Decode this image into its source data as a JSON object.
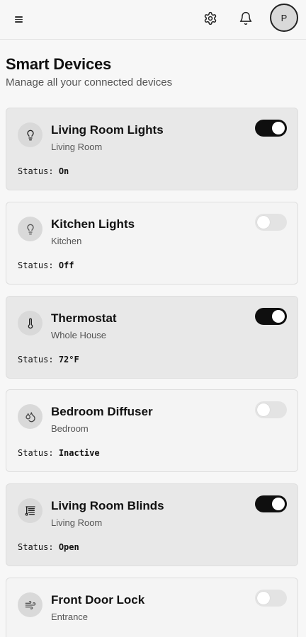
{
  "header": {
    "menu_icon": "hamburger-menu-icon",
    "settings_icon": "gear-icon",
    "notifications_icon": "bell-icon",
    "avatar_initial": "P"
  },
  "page": {
    "title": "Smart Devices",
    "subtitle": "Manage all your connected devices"
  },
  "status_label": "Status:",
  "colors": {
    "toggle_on": "#0f0f0f",
    "toggle_off": "#e3e3e3",
    "card_active": "#e8e8e8",
    "card_inactive": "#f4f4f4"
  },
  "devices": [
    {
      "name": "Living Room Lights",
      "room": "Living Room",
      "status": "On",
      "enabled": true,
      "icon": "lightbulb-icon"
    },
    {
      "name": "Kitchen Lights",
      "room": "Kitchen",
      "status": "Off",
      "enabled": false,
      "icon": "lightbulb-icon"
    },
    {
      "name": "Thermostat",
      "room": "Whole House",
      "status": "72°F",
      "enabled": true,
      "icon": "thermometer-icon"
    },
    {
      "name": "Bedroom Diffuser",
      "room": "Bedroom",
      "status": "Inactive",
      "enabled": false,
      "icon": "droplets-icon"
    },
    {
      "name": "Living Room Blinds",
      "room": "Living Room",
      "status": "Open",
      "enabled": true,
      "icon": "blinds-icon"
    },
    {
      "name": "Front Door Lock",
      "room": "Entrance",
      "status": "",
      "enabled": false,
      "icon": "wind-icon"
    }
  ]
}
